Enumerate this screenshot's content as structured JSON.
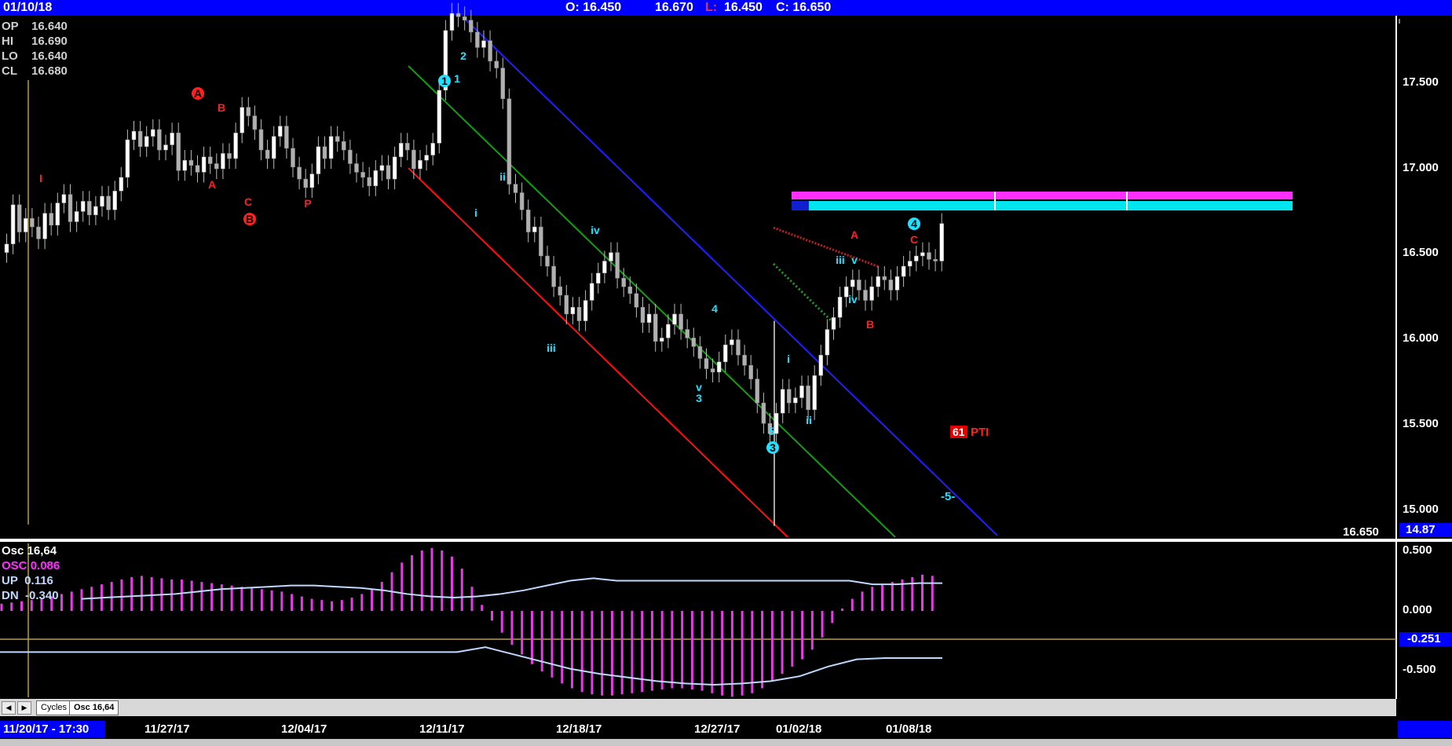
{
  "header": {
    "date": "01/10/18",
    "open": "O: 16.450",
    "high": "16.670",
    "low_label": "L:",
    "low": "16.450",
    "close": "C: 16.650"
  },
  "ohlc_panel": [
    {
      "k": "OP",
      "v": "16.640"
    },
    {
      "k": "HI",
      "v": "16.690"
    },
    {
      "k": "LO",
      "v": "16.640"
    },
    {
      "k": "CL",
      "v": "16.680"
    }
  ],
  "price_axis": {
    "ticks": [
      "17.500",
      "17.000",
      "16.500",
      "16.000",
      "15.500",
      "15.000"
    ],
    "last_price": "16.650",
    "marker": "14.87"
  },
  "osc_panel": {
    "title_label": "Osc",
    "title_value": "16,64",
    "osc_label": "OSC",
    "osc_value": "0.086",
    "up_label": "UP",
    "up_value": "0.116",
    "dn_label": "DN",
    "dn_value": "-0.340",
    "axis_ticks": [
      "0.500",
      "0.000",
      "-0.500"
    ],
    "level_marker": "-0.251"
  },
  "tabs": {
    "cycles": "Cycles",
    "osc": "Osc 16,64"
  },
  "date_axis": {
    "start": "11/20/17 - 17:30",
    "labels": [
      "11/27/17",
      "12/04/17",
      "12/11/17",
      "12/18/17",
      "12/27/17",
      "01/02/18",
      "01/08/18"
    ]
  },
  "annotations": {
    "pti_box": "61",
    "pti_text": "PTI",
    "minus5": "-5-",
    "wave_labels": [
      "I",
      "A",
      "B",
      "A",
      "C",
      "B",
      "P",
      "1",
      "2",
      "1",
      "i",
      "ii",
      "iii",
      "iv",
      "4",
      "v",
      "3",
      "5",
      "3",
      "i",
      "ii",
      "iii",
      "iv",
      "v",
      "A",
      "B",
      "C",
      "4"
    ]
  },
  "colors": {
    "up": "#ffffff",
    "down": "#b0b0b0",
    "wave_red": "#ff2020",
    "wave_cyan": "#22e0ff",
    "osc": "#e040e0",
    "channel_blue": "#2020ff",
    "channel_green": "#10a010",
    "channel_red": "#ff1010",
    "signal": "#c0d8ff",
    "magenta_zone": "#ff30ff",
    "cyan_zone": "#00e5ee"
  },
  "chart_data": {
    "type": "candlestick",
    "y_range": [
      14.9,
      17.85
    ],
    "candles": [
      16.55,
      16.78,
      16.62,
      16.7,
      16.65,
      16.58,
      16.73,
      16.66,
      16.79,
      16.84,
      16.68,
      16.74,
      16.8,
      16.72,
      16.77,
      16.83,
      16.75,
      16.86,
      16.94,
      17.16,
      17.21,
      17.12,
      17.18,
      17.22,
      17.1,
      17.13,
      17.2,
      16.98,
      17.04,
      17.01,
      16.97,
      17.06,
      17.02,
      16.99,
      17.08,
      17.05,
      17.2,
      17.35,
      17.3,
      17.22,
      17.1,
      17.05,
      17.18,
      17.24,
      17.11,
      17.0,
      16.93,
      16.88,
      16.96,
      17.12,
      17.05,
      17.18,
      17.15,
      17.1,
      17.02,
      16.97,
      16.94,
      16.89,
      16.98,
      17.01,
      16.93,
      17.06,
      17.14,
      17.1,
      16.99,
      17.04,
      17.07,
      17.14,
      17.45,
      17.8,
      17.9,
      17.88,
      17.86,
      17.79,
      17.7,
      17.74,
      17.62,
      17.58,
      17.4,
      16.9,
      16.85,
      16.75,
      16.62,
      16.65,
      16.48,
      16.42,
      16.3,
      16.25,
      16.14,
      16.18,
      16.1,
      16.22,
      16.32,
      16.38,
      16.45,
      16.5,
      16.35,
      16.3,
      16.26,
      16.18,
      16.09,
      16.14,
      15.98,
      16.0,
      16.08,
      16.14,
      16.05,
      16.0,
      15.95,
      15.88,
      15.82,
      15.8,
      15.86,
      15.96,
      15.99,
      15.9,
      15.84,
      15.76,
      15.62,
      15.5,
      15.44,
      15.56,
      15.7,
      15.62,
      15.65,
      15.72,
      15.58,
      15.78,
      15.9,
      16.05,
      16.12,
      16.24,
      16.3,
      16.34,
      16.28,
      16.22,
      16.3,
      16.36,
      16.34,
      16.28,
      16.36,
      16.42,
      16.45,
      16.48,
      16.5,
      16.46,
      16.45,
      16.67
    ],
    "oscillator": {
      "histogram": [
        0.06,
        0.07,
        0.08,
        0.09,
        0.1,
        0.12,
        0.14,
        0.16,
        0.18,
        0.2,
        0.22,
        0.24,
        0.26,
        0.28,
        0.29,
        0.28,
        0.27,
        0.26,
        0.26,
        0.25,
        0.24,
        0.23,
        0.22,
        0.21,
        0.2,
        0.19,
        0.18,
        0.17,
        0.16,
        0.14,
        0.12,
        0.1,
        0.09,
        0.08,
        0.09,
        0.11,
        0.14,
        0.18,
        0.24,
        0.32,
        0.4,
        0.46,
        0.5,
        0.52,
        0.5,
        0.45,
        0.35,
        0.2,
        0.05,
        -0.08,
        -0.18,
        -0.28,
        -0.36,
        -0.44,
        -0.5,
        -0.55,
        -0.6,
        -0.64,
        -0.67,
        -0.69,
        -0.7,
        -0.7,
        -0.69,
        -0.68,
        -0.67,
        -0.66,
        -0.65,
        -0.64,
        -0.64,
        -0.65,
        -0.66,
        -0.68,
        -0.7,
        -0.71,
        -0.7,
        -0.68,
        -0.64,
        -0.58,
        -0.52,
        -0.46,
        -0.4,
        -0.32,
        -0.22,
        -0.1,
        0.02,
        0.1,
        0.16,
        0.2,
        0.22,
        0.24,
        0.26,
        0.28,
        0.3,
        0.29
      ],
      "up_line": [
        0.1,
        0.11,
        0.12,
        0.13,
        0.14,
        0.16,
        0.18,
        0.19,
        0.2,
        0.21,
        0.21,
        0.2,
        0.19,
        0.17,
        0.14,
        0.12,
        0.11,
        0.12,
        0.14,
        0.17,
        0.21,
        0.25,
        0.27,
        0.25,
        0.25,
        0.25,
        0.25,
        0.25,
        0.25,
        0.25,
        0.25,
        0.25,
        0.25,
        0.25,
        0.22,
        0.22,
        0.23,
        0.23
      ],
      "dn_line": [
        -0.34,
        -0.34,
        -0.34,
        -0.34,
        -0.34,
        -0.34,
        -0.34,
        -0.34,
        -0.34,
        -0.34,
        -0.34,
        -0.34,
        -0.34,
        -0.34,
        -0.34,
        -0.34,
        -0.34,
        -0.3,
        -0.36,
        -0.42,
        -0.48,
        -0.52,
        -0.55,
        -0.58,
        -0.6,
        -0.61,
        -0.6,
        -0.58,
        -0.54,
        -0.46,
        -0.4,
        -0.39,
        -0.39,
        -0.39
      ]
    }
  }
}
